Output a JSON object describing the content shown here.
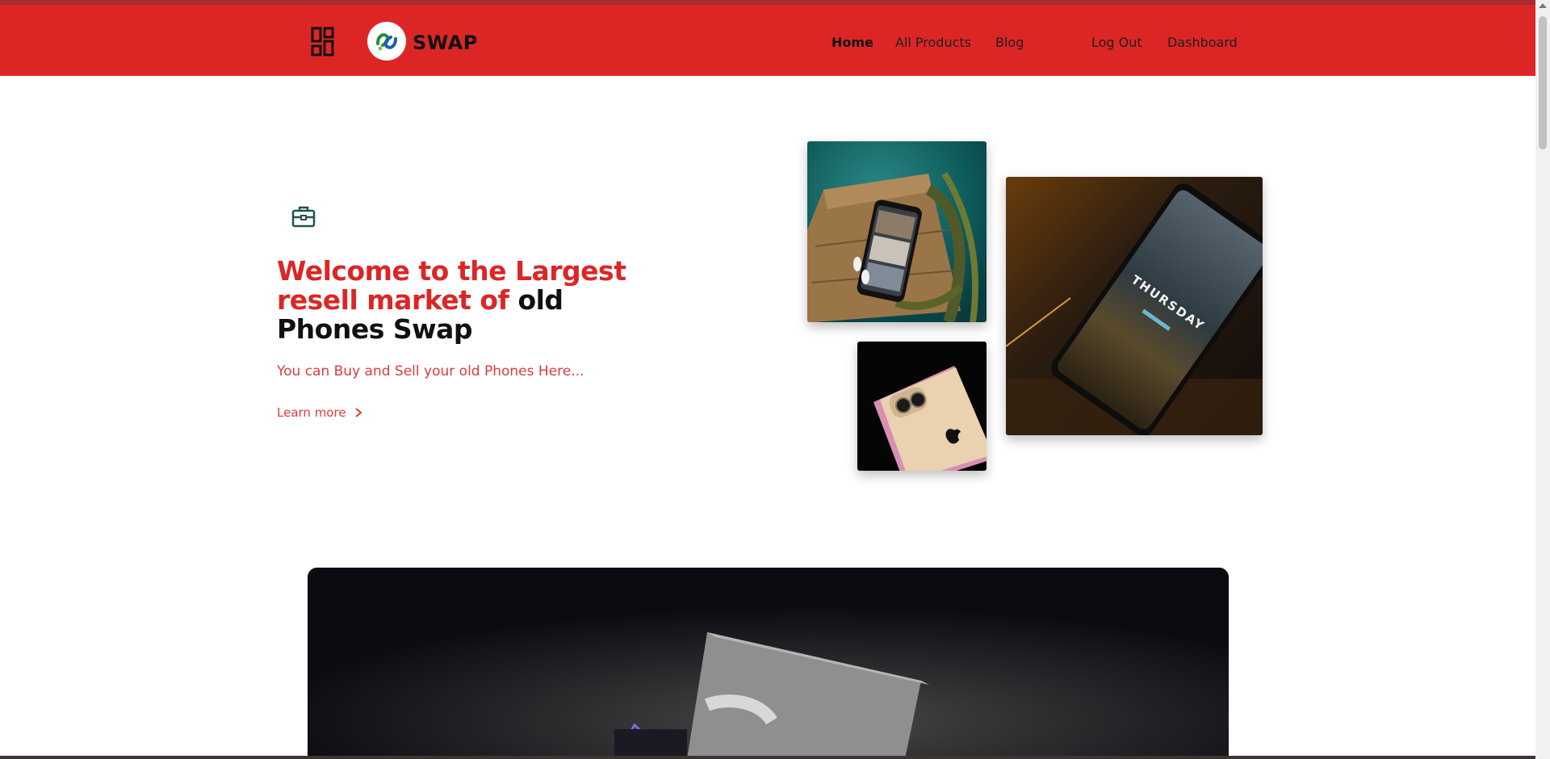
{
  "header": {
    "brand": "SWAP",
    "nav": [
      {
        "label": "Home"
      },
      {
        "label": "All Products"
      },
      {
        "label": "Blog"
      },
      {
        "label": "Log Out"
      },
      {
        "label": "Dashboard"
      }
    ]
  },
  "hero": {
    "title_red": "Welcome to the Largest resell market of",
    "title_dark": " old Phones Swap",
    "subtitle": "You can Buy and Sell your old Phones Here...",
    "learn_more": "Learn more"
  },
  "images": [
    {
      "icon": "phone-on-wooden-table-photo"
    },
    {
      "icon": "iphone-in-box-photo"
    },
    {
      "icon": "phone-thursday-screen-photo",
      "screen_text": "THURSDAY"
    }
  ],
  "colors": {
    "navbar": "#dc2626",
    "accent": "#dc2626",
    "text_dark": "#111111"
  }
}
